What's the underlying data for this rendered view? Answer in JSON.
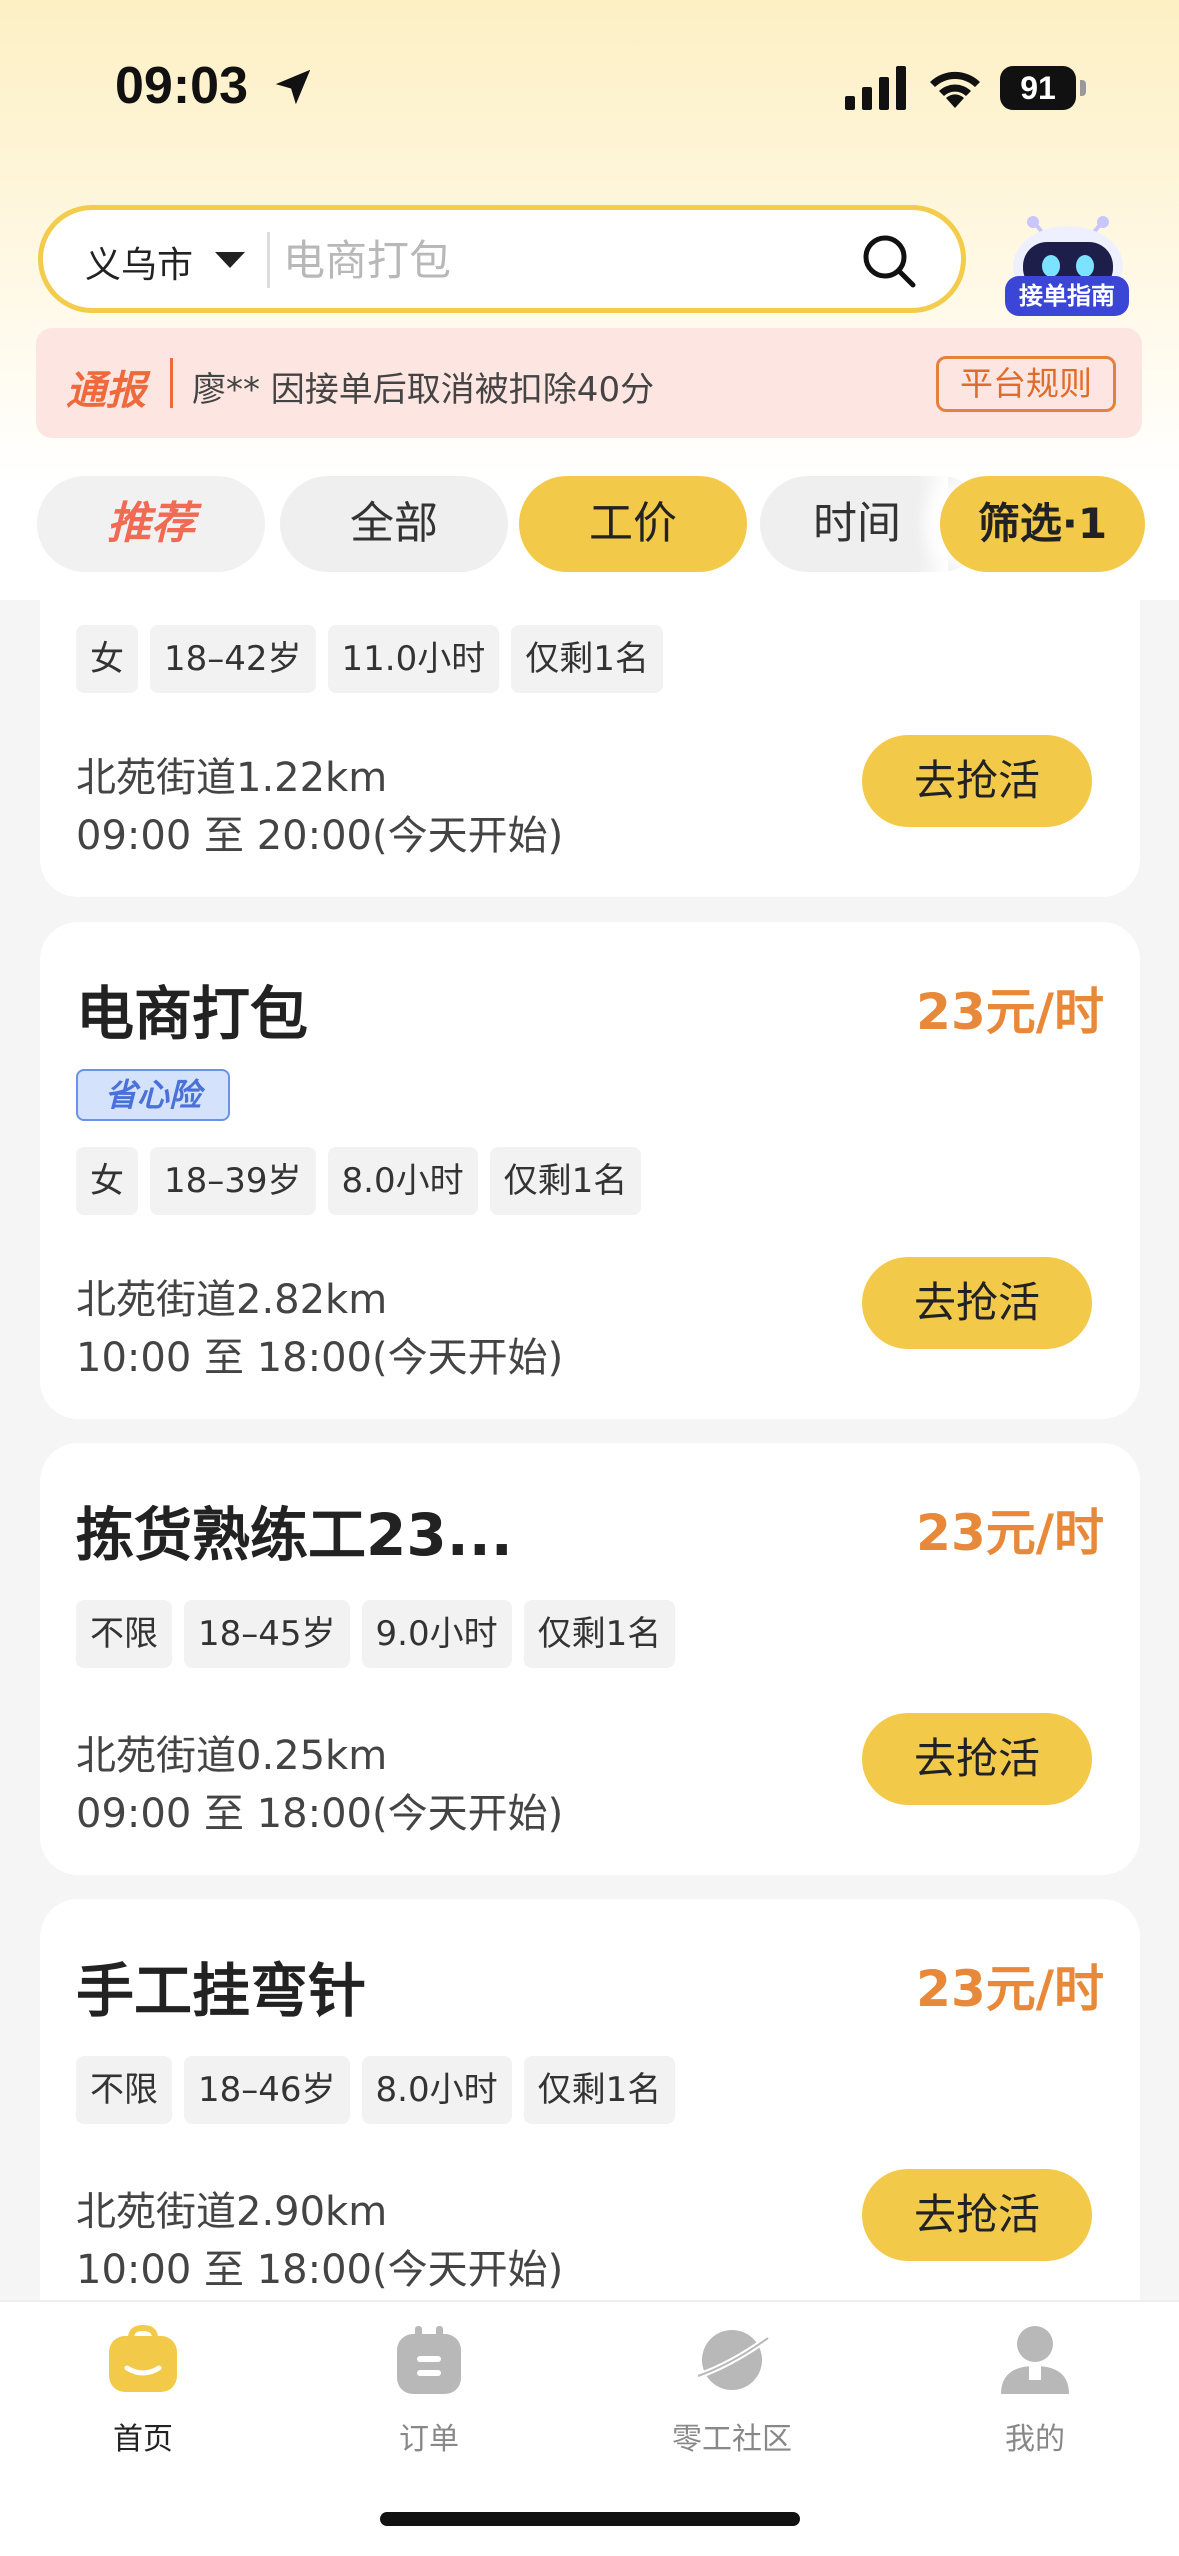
{
  "status_bar": {
    "time": "09:03",
    "battery": "91"
  },
  "search": {
    "city": "义乌市",
    "placeholder": "电商打包"
  },
  "guide": {
    "label": "接单指南"
  },
  "notice": {
    "tag": "通报",
    "text": "廖** 因接单后取消被扣除40分",
    "rules_label": "平台规则"
  },
  "tabs": [
    {
      "label": "推荐"
    },
    {
      "label": "全部"
    },
    {
      "label": "工价"
    },
    {
      "label": "时间"
    }
  ],
  "filter_label": "筛选·1",
  "cards": [
    {
      "title": "",
      "pay": "",
      "tags": [
        "女",
        "18–42岁",
        "11.0小时",
        "仅剩1名"
      ],
      "location": "北苑街道1.22km",
      "time": "09:00 至 20:00(今天开始)",
      "button": "去抢活"
    },
    {
      "title": "电商打包",
      "pay": "23元/时",
      "badge": "省心险",
      "tags": [
        "女",
        "18–39岁",
        "8.0小时",
        "仅剩1名"
      ],
      "location": "北苑街道2.82km",
      "time": "10:00 至 18:00(今天开始)",
      "button": "去抢活"
    },
    {
      "title": "拣货熟练工23...",
      "pay": "23元/时",
      "tags": [
        "不限",
        "18–45岁",
        "9.0小时",
        "仅剩1名"
      ],
      "location": "北苑街道0.25km",
      "time": "09:00 至 18:00(今天开始)",
      "button": "去抢活"
    },
    {
      "title": "手工挂弯针",
      "pay": "23元/时",
      "tags": [
        "不限",
        "18–46岁",
        "8.0小时",
        "仅剩1名"
      ],
      "location": "北苑街道2.90km",
      "time": "10:00 至 18:00(今天开始)",
      "button": "去抢活"
    }
  ],
  "bottom_nav": [
    {
      "label": "首页",
      "icon": "home-bag-icon"
    },
    {
      "label": "订单",
      "icon": "orders-icon"
    },
    {
      "label": "零工社区",
      "icon": "community-planet-icon"
    },
    {
      "label": "我的",
      "icon": "profile-icon"
    }
  ],
  "colors": {
    "accent": "#f3c94a",
    "pay": "#e8893a",
    "notice_bg": "#fde6e2",
    "notice_accent": "#ee6a3d"
  }
}
